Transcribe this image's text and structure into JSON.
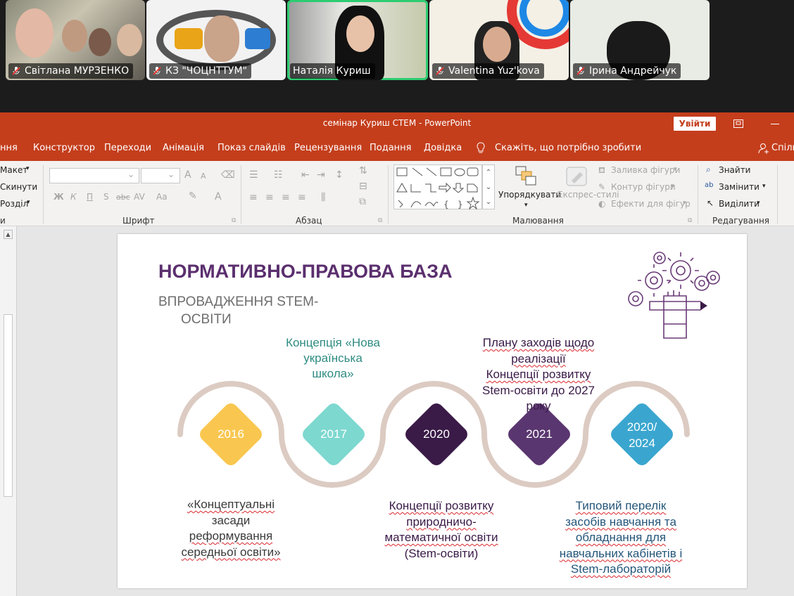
{
  "participants": [
    {
      "name": "Світлана МУРЗЕНКО",
      "muted": true
    },
    {
      "name": "КЗ \"ЧОЦНТТУМ\"",
      "muted": true
    },
    {
      "name": "Наталія Куриш",
      "muted": false,
      "active": true
    },
    {
      "name": "Valentina  Yuz'kova",
      "muted": true
    },
    {
      "name": "Ірина Андрейчук",
      "muted": true
    }
  ],
  "window": {
    "title": "семінар Куриш СТЕМ  -  PowerPoint",
    "signin_label": "Увійти",
    "share_label": "Спіль"
  },
  "menu": {
    "items": [
      "ння",
      "Конструктор",
      "Переходи",
      "Анімація",
      "Показ слайдів",
      "Рецензування",
      "Подання",
      "Довідка"
    ],
    "tell_me": "Скажіть, що потрібно зробити"
  },
  "ribbon": {
    "slides": {
      "layout": "Макет",
      "reset": "Скинути",
      "section": "Розділ",
      "group": "и"
    },
    "font": {
      "group": "Шрифт",
      "bold": "Ж",
      "italic": "К",
      "underline": "П",
      "shadow": "S",
      "strike": "abc",
      "spacing": "AV",
      "case": "Aa",
      "grow": "A",
      "shrink": "A"
    },
    "paragraph": {
      "group": "Абзац"
    },
    "drawing": {
      "group": "Малювання",
      "arrange": "Упорядкувати",
      "quick_styles": "Експрес-стилі",
      "fill": "Заливка фігури",
      "outline": "Контур фігури",
      "effects": "Ефекти для фігур"
    },
    "editing": {
      "group": "Редагування",
      "find": "Знайти",
      "replace": "Замінити",
      "select": "Виділити"
    }
  },
  "slide": {
    "title": "НОРМАТИВНО-ПРАВОВА БАЗА",
    "subtitle_line1": "ВПРОВАДЖЕННЯ STEM-",
    "subtitle_line2": "ОСВІТИ",
    "top_left_line1": "Концепція «Нова",
    "top_left_line2": "українська",
    "top_left_line3": "школа»",
    "top_right_line1": "Плану заходів щодо",
    "top_right_line2": "реалізації",
    "top_right_line3": "Концепції розвитку",
    "top_right_line4": "Stem-освіти до 2027",
    "top_right_line5": "року",
    "years": [
      {
        "label": "2016",
        "color": "#f9c74f"
      },
      {
        "label": "2017",
        "color": "#7dd8cf"
      },
      {
        "label": "2020",
        "color": "#3a1a47"
      },
      {
        "label": "2021",
        "color": "#5a3670"
      },
      {
        "label": "2020/\n2024",
        "color": "#3aa6cf"
      }
    ],
    "bottom_left": [
      "«Концептуальні",
      "засади",
      "реформування",
      "середньої освіти»"
    ],
    "bottom_mid": [
      "Концепції розвитку",
      "природничо-",
      "математичної освіти",
      "(Stem-освіти)"
    ],
    "bottom_right": [
      "Типовий перелік",
      "засобів навчання та",
      "обладнання для",
      "навчальних кабінетів і",
      "Stem-лабораторій"
    ]
  }
}
